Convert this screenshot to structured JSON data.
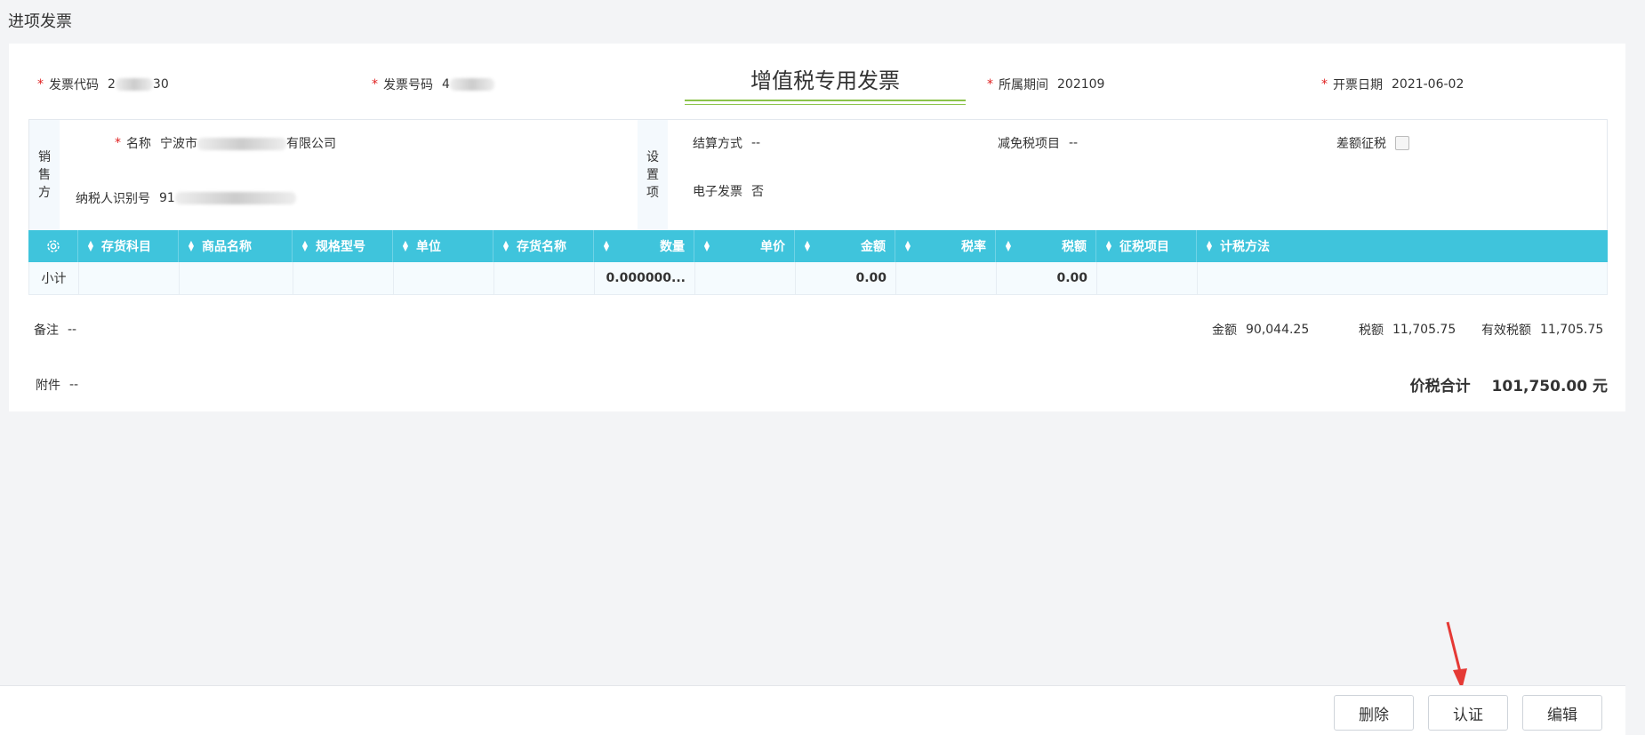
{
  "page": {
    "title": "进项发票"
  },
  "header": {
    "invoice_code": {
      "label": "发票代码",
      "value_start": "2",
      "value_end": "30"
    },
    "invoice_number": {
      "label": "发票号码",
      "value_start": "4"
    },
    "invoice_title": "增值税专用发票",
    "period": {
      "label": "所属期间",
      "value": "202109"
    },
    "issue_date": {
      "label": "开票日期",
      "value": "2021-06-02"
    }
  },
  "seller": {
    "tab_chars": [
      "销",
      "售",
      "方"
    ],
    "name": {
      "label": "名称",
      "value_start": "宁波市",
      "value_end": "有限公司"
    },
    "tax_id": {
      "label": "纳税人识别号",
      "value_start": "91"
    }
  },
  "settings": {
    "tab_chars": [
      "设",
      "置",
      "项"
    ],
    "settlement": {
      "label": "结算方式",
      "value": "--"
    },
    "tax_exempt": {
      "label": "减免税项目",
      "value": "--"
    },
    "diff_tax": {
      "label": "差额征税"
    },
    "e_invoice": {
      "label": "电子发票",
      "value": "否"
    }
  },
  "table": {
    "settings_icon": "gear-icon",
    "columns": [
      "存货科目",
      "商品名称",
      "规格型号",
      "单位",
      "存货名称",
      "数量",
      "单价",
      "金额",
      "税率",
      "税额",
      "征税项目",
      "计税方法"
    ],
    "subtotal": {
      "label": "小计",
      "quantity": "0.000000...",
      "amount": "0.00",
      "tax": "0.00"
    }
  },
  "summary": {
    "remark": {
      "label": "备注",
      "value": "--"
    },
    "attachment": {
      "label": "附件",
      "value": "--"
    },
    "amount": {
      "label": "金额",
      "value": "90,044.25"
    },
    "tax": {
      "label": "税额",
      "value": "11,705.75"
    },
    "valid_tax": {
      "label": "有效税额",
      "value": "11,705.75"
    },
    "total": {
      "label": "价税合计",
      "value": "101,750.00 元"
    }
  },
  "footer": {
    "delete": "删除",
    "certify": "认证",
    "edit": "编辑"
  },
  "colors": {
    "accent": "#3fc4dc",
    "required": "#e02020",
    "title_underline": "#8bc34a",
    "annotation_arrow": "#e53935"
  }
}
